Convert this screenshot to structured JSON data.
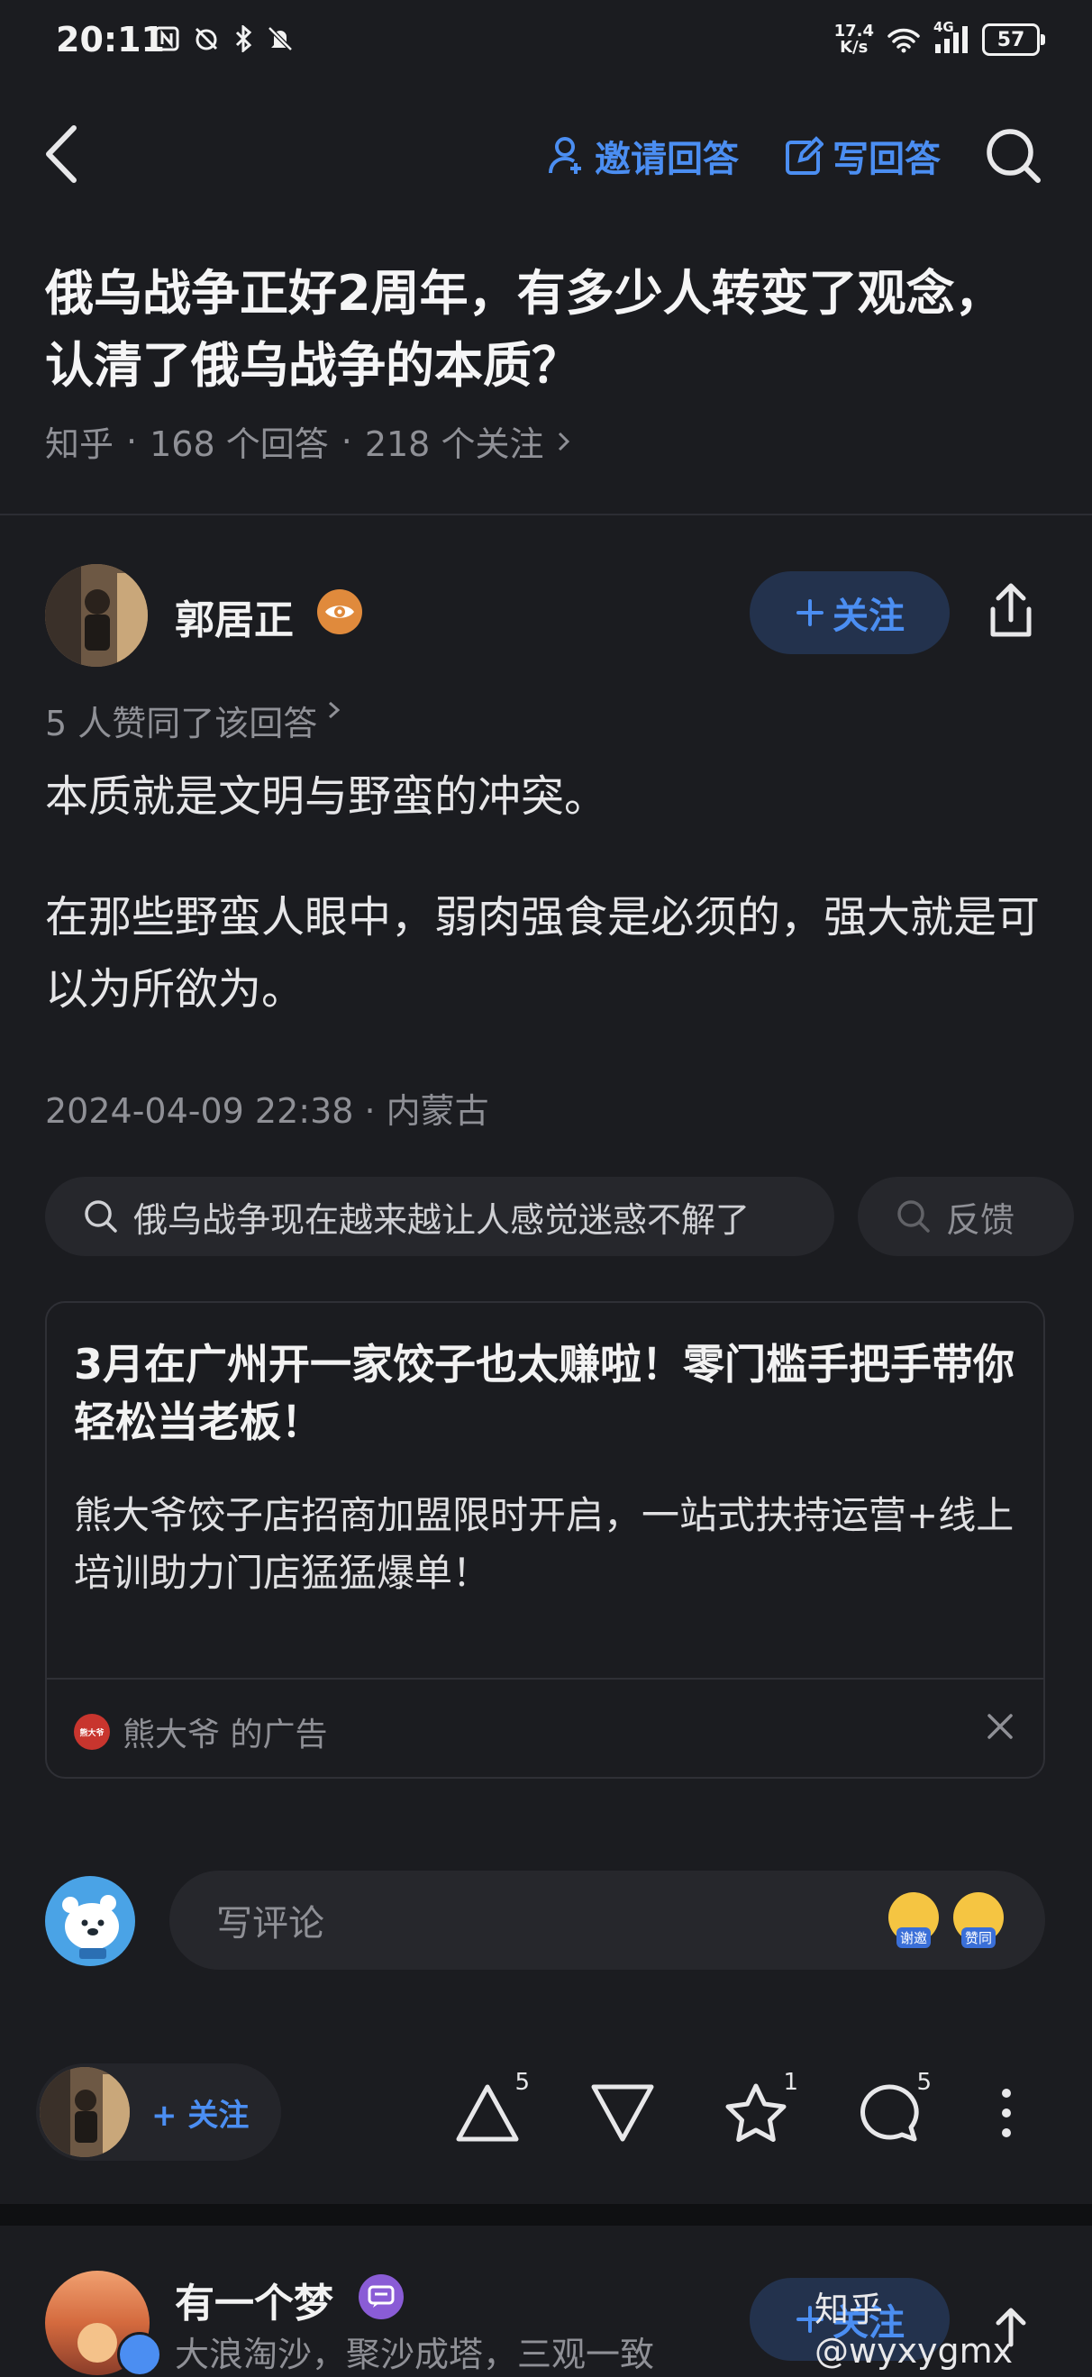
{
  "status_bar": {
    "time": "20:11",
    "net_speed_value": "17.4",
    "net_speed_unit": "K/s",
    "network_type": "4G",
    "battery": "57"
  },
  "nav": {
    "invite_answer": "邀请回答",
    "write_answer": "写回答"
  },
  "question": {
    "title": "俄乌战争正好2周年，有多少人转变了观念，认清了俄乌战争的本质？",
    "source": "知乎",
    "answers_count": "168 个回答",
    "followers_count": "218 个关注"
  },
  "answer": {
    "author_name": "郭居正",
    "follow_label": "关注",
    "upvote_note": "5 人赞同了该回答",
    "paragraphs": [
      "本质就是文明与野蛮的冲突。",
      "在那些野蛮人眼中，弱肉强食是必须的，强大就是可以为所欲为。"
    ],
    "timestamp": "2024-04-09 22:38 · 内蒙古"
  },
  "related_search": {
    "query": "俄乌战争现在越来越让人感觉迷惑不解了",
    "feedback": "反馈"
  },
  "ad": {
    "title": "3月在广州开一家饺子也太赚啦！零门槛手把手带你轻松当老板！",
    "description": "熊大爷饺子店招商加盟限时开启，一站式扶持运营+线上培训助力门店猛猛爆单！",
    "advertiser": "熊大爷 的广告",
    "logo_text": "熊大爷"
  },
  "comment_bar": {
    "placeholder": "写评论",
    "emoji_thanks": "谢邀",
    "emoji_agree": "赞同"
  },
  "action_bar": {
    "follow_label": "+ 关注",
    "upvote_count": "5",
    "favorite_count": "1",
    "comment_count": "5"
  },
  "next_answer": {
    "author_name": "有一个梦",
    "author_bio": "大浪淘沙，聚沙成塔，三观一致",
    "follow_label": "关注"
  },
  "watermark": "知乎 @wyxygmx",
  "colors": {
    "background": "#1b1c20",
    "accent": "#4b8ef2",
    "muted_text": "#8f9096"
  }
}
